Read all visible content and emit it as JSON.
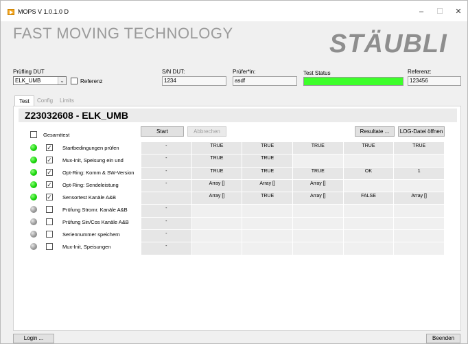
{
  "window": {
    "title": "MOPS V 1.0.1.0 D",
    "min": "–",
    "max": "☐",
    "close": "✕"
  },
  "brand": {
    "tagline": "FAST MOVING TECHNOLOGY",
    "logo": "STÄUBLI"
  },
  "header": {
    "pruefling_label": "Prüfling DUT",
    "pruefling_value": "ELK_UMB",
    "referenz_checkbox_label": "Referenz",
    "sn_label": "S/N DUT:",
    "sn_value": "1234",
    "pruefer_label": "Prüfer*in:",
    "pruefer_value": "asdf",
    "status_label": "Test Status",
    "status_color": "#3dfe2a",
    "referenz_label": "Referenz:",
    "referenz_value": "123456"
  },
  "tabs": [
    "Test",
    "Config",
    "Limits"
  ],
  "dut_title": "Z23032608 - ELK_UMB",
  "gesamttest_label": "Gesamttest",
  "buttons": {
    "start": "Start",
    "abbrechen": "Abbrechen",
    "resultate": "Resultate ...",
    "log": "LOG-Datei öffnen",
    "login": "Login ...",
    "beenden": "Beenden"
  },
  "steps": [
    {
      "label": "Startbedingungen prüfen",
      "led": "green",
      "checked": true,
      "cells": [
        "-",
        "TRUE",
        "TRUE",
        "TRUE",
        "TRUE",
        "TRUE"
      ]
    },
    {
      "label": "Mux-Init, Speisung ein und",
      "led": "green",
      "checked": true,
      "cells": [
        "-",
        "TRUE",
        "TRUE",
        "",
        "",
        ""
      ]
    },
    {
      "label": "Opt-Ring: Komm & SW-Version",
      "led": "green",
      "checked": true,
      "cells": [
        "-",
        "TRUE",
        "TRUE",
        "TRUE",
        "OK",
        "1"
      ]
    },
    {
      "label": "Opt-Ring: Sendeleistung",
      "led": "green",
      "checked": true,
      "cells": [
        "-",
        "Array []",
        "Array []",
        "Array []",
        "",
        ""
      ]
    },
    {
      "label": "Sensortest Kanäle A&B",
      "led": "green",
      "checked": true,
      "cells": [
        "",
        "Array []",
        "TRUE",
        "Array []",
        "FALSE",
        "Array []"
      ]
    },
    {
      "label": "Prüfung Stromr. Kanäle A&B",
      "led": "gray",
      "checked": false,
      "cells": [
        "-",
        "",
        "",
        "",
        "",
        ""
      ]
    },
    {
      "label": "Prüfung Sin/Cos Kanäle A&B",
      "led": "gray",
      "checked": false,
      "cells": [
        "-",
        "",
        "",
        "",
        "",
        ""
      ]
    },
    {
      "label": "Seriennummer speichern",
      "led": "gray",
      "checked": false,
      "cells": [
        "-",
        "",
        "",
        "",
        "",
        ""
      ]
    },
    {
      "label": "Mux-Init,  Speisungen",
      "led": "gray",
      "checked": false,
      "cells": [
        "-",
        "",
        "",
        "",
        "",
        ""
      ]
    }
  ]
}
